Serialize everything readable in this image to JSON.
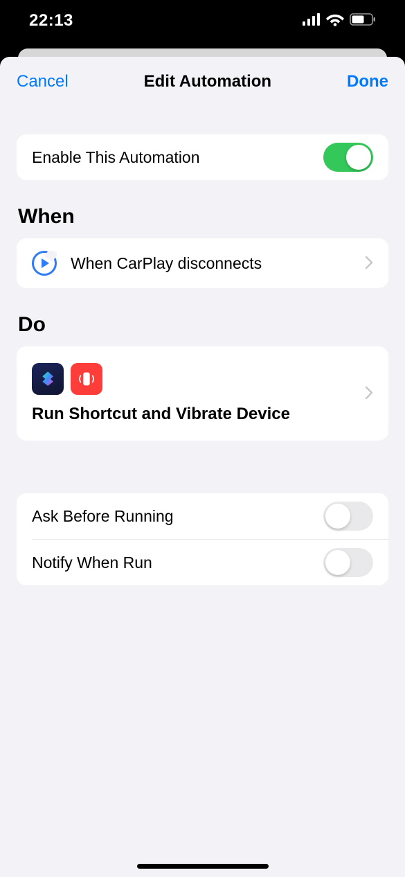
{
  "status": {
    "time": "22:13"
  },
  "nav": {
    "cancel": "Cancel",
    "title": "Edit Automation",
    "done": "Done"
  },
  "enable": {
    "label": "Enable This Automation",
    "on": true
  },
  "sections": {
    "when": "When",
    "do": "Do"
  },
  "when": {
    "text": "When CarPlay disconnects"
  },
  "do": {
    "text": "Run Shortcut and Vibrate Device"
  },
  "settings": {
    "ask": {
      "label": "Ask Before Running",
      "on": false
    },
    "notify": {
      "label": "Notify When Run",
      "on": false
    }
  }
}
